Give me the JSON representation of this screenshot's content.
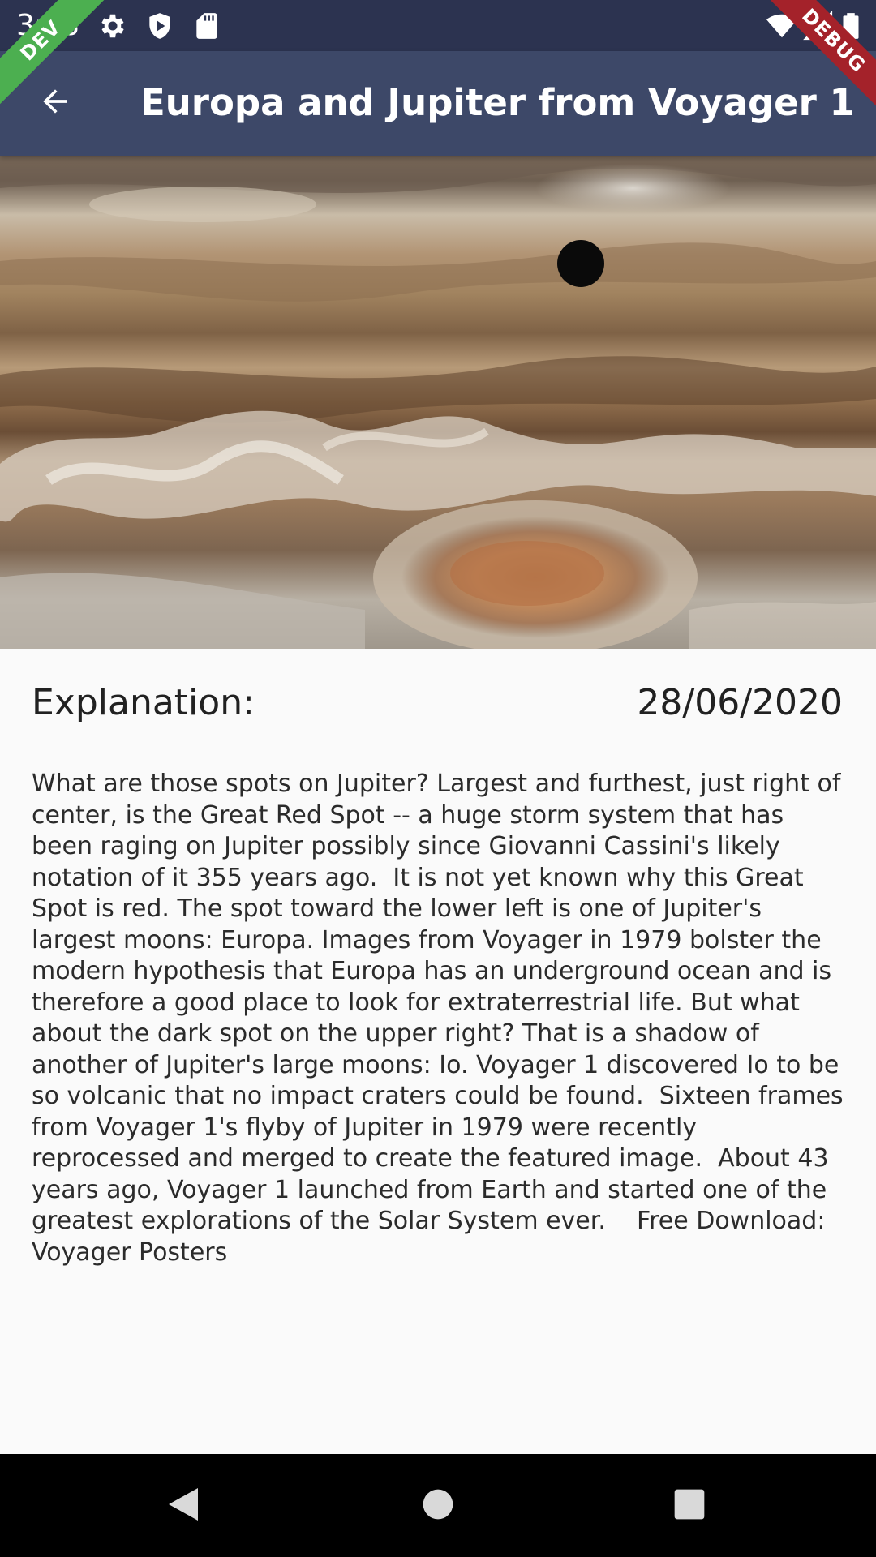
{
  "status_bar": {
    "time": "3:48",
    "icons_left": [
      "settings-icon",
      "shield-play-icon",
      "sd-card-icon"
    ],
    "icons_right": [
      "wifi-icon",
      "signal-icon",
      "battery-icon"
    ]
  },
  "banners": {
    "dev": "DEV",
    "debug": "DEBUG"
  },
  "app_bar": {
    "title": "Europa and Jupiter from Voyager 1",
    "back_icon": "arrow-back-icon"
  },
  "content": {
    "heading": "Explanation:",
    "date": "28/06/2020",
    "explanation": "What are those spots on Jupiter? Largest and furthest, just right of center, is the Great Red Spot -- a huge storm system that has been raging on Jupiter possibly since Giovanni Cassini's likely notation of it 355 years ago.  It is not yet known why this Great Spot is red. The spot toward the lower left is one of Jupiter's largest moons: Europa. Images from Voyager in 1979 bolster the modern hypothesis that Europa has an underground ocean and is therefore a good place to look for extraterrestrial life. But what about the dark spot on the upper right? That is a shadow of another of Jupiter's large moons: Io. Voyager 1 discovered Io to be so volcanic that no impact craters could be found.  Sixteen frames from Voyager 1's flyby of Jupiter in 1979 were recently reprocessed and merged to create the featured image.  About 43 years ago, Voyager 1 launched from Earth and started one of the greatest explorations of the Solar System ever.    Free Download: Voyager Posters"
  },
  "nav_bar": {
    "buttons": [
      "nav-back-icon",
      "nav-home-icon",
      "nav-recents-icon"
    ]
  },
  "colors": {
    "status_bar": "#2c3350",
    "app_bar": "#3d4868",
    "background": "#fafafa",
    "dev_banner": "#4caf50",
    "debug_banner": "#a4222a"
  }
}
